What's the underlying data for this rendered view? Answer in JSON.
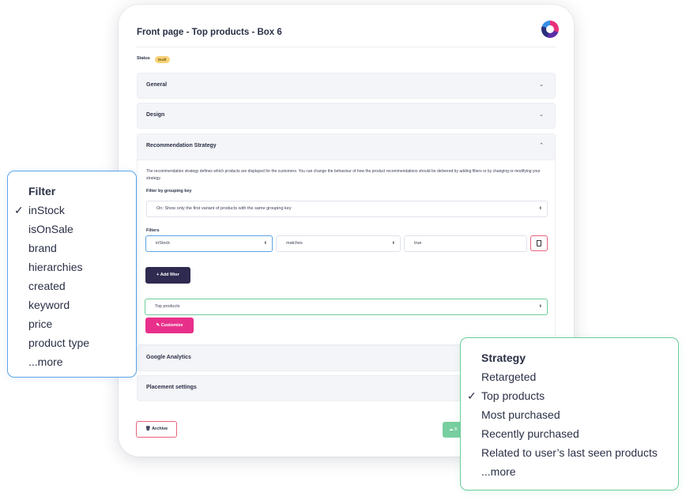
{
  "card": {
    "title": "Front page - Top products - Box 6",
    "status_label": "Status",
    "status_badge": "Draft"
  },
  "sections": {
    "general": "General",
    "design": "Design",
    "recommendation": "Recommendation Strategy",
    "google_analytics": "Google Analytics",
    "placement": "Placement settings"
  },
  "recommendation": {
    "description": "The recommendation strategy defines which products are displayed for the customers. You can change the behaviour of how the product recommendations should be delivered by adding filters or by changing or modifying your strategy.",
    "grouping_label": "Filter by grouping key",
    "grouping_value": "On: Show only the first variant of products with the same grouping key",
    "filters_label": "Filters",
    "filter_field": "inStock",
    "filter_operator": "matches",
    "filter_value": "true",
    "add_filter": "+  Add filter",
    "strategy_value": "Top products",
    "customize": "Customize"
  },
  "footer": {
    "archive": "Archive",
    "green_button_partial": "B"
  },
  "filter_popup": {
    "title": "Filter",
    "items": [
      "inStock",
      "isOnSale",
      "brand",
      "hierarchies",
      "created",
      "keyword",
      "price",
      "product type",
      "...more"
    ],
    "selected_index": 0
  },
  "strategy_popup": {
    "title": "Strategy",
    "items": [
      "Retargeted",
      "Top products",
      "Most purchased",
      "Recently purchased",
      "Related to user’s last seen products",
      "...more"
    ],
    "selected_index": 1
  },
  "colors": {
    "brand_pink": "#e8308a",
    "dark_button": "#2f2b50",
    "filter_border": "#5ba3e6",
    "strategy_border": "#6bcd98",
    "status_badge": "#f8d27a"
  }
}
